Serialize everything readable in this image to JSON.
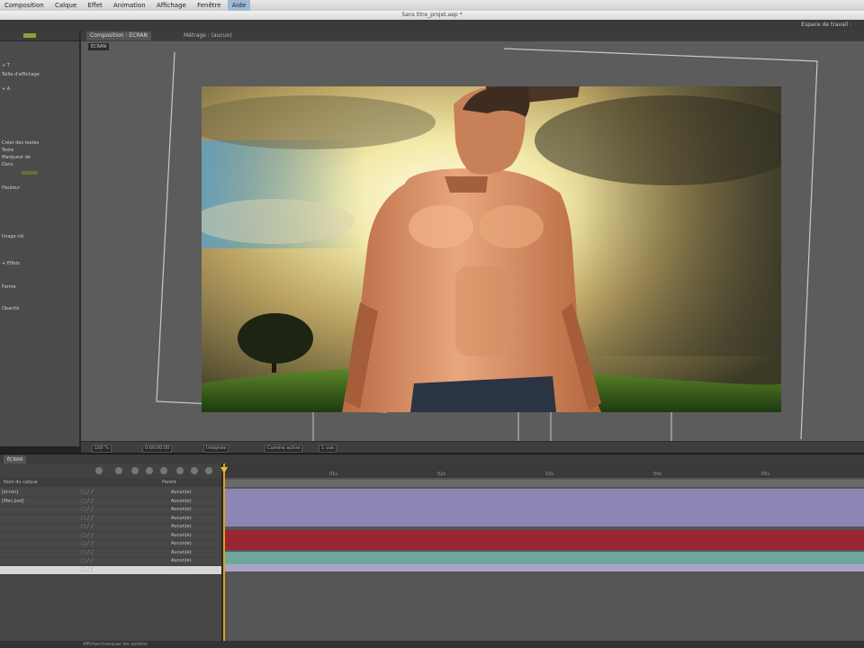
{
  "menu": {
    "items": [
      "Composition",
      "Calque",
      "Effet",
      "Animation",
      "Affichage",
      "Fenêtre",
      "Aide"
    ],
    "selected_index": 6
  },
  "window": {
    "title": "Sans titre_projet.aep *"
  },
  "workspace": {
    "label": "Espace de travail :"
  },
  "left_panel": {
    "rows": [
      "+ T",
      "Taille d'affichage",
      "+ A",
      "Créer des textes",
      "Texte",
      "Marqueur de",
      "Dans",
      "Hauteur",
      "Image clé",
      "+ Effets",
      "Forme",
      "Opacité"
    ]
  },
  "comp_panel": {
    "tabs": [
      "Composition : ÉCRAN",
      "Métrage : (aucun)"
    ],
    "active_tab": 0,
    "badge": "ÉCRAN"
  },
  "viewer_controls": [
    "100 %",
    "0:00:00:00",
    "Intégrale",
    "Caméra active",
    "1 vue"
  ],
  "timeline": {
    "tab": "ÉCRAN",
    "header": {
      "col_source": "Nom du calque",
      "col_parent": "Parent"
    },
    "layers": [
      {
        "name": "[écran]",
        "parent": "Aucun(e)"
      },
      {
        "name": "[Mec.psd]",
        "parent": "Aucun(e)"
      },
      {
        "name": "",
        "parent": "Aucun(e)"
      },
      {
        "name": "",
        "parent": "Aucun(e)"
      },
      {
        "name": "",
        "parent": "Aucun(e)"
      },
      {
        "name": "",
        "parent": "Aucun(e)"
      },
      {
        "name": "",
        "parent": "Aucun(e)"
      },
      {
        "name": "",
        "parent": "Aucun(e)"
      },
      {
        "name": "",
        "parent": "Aucun(e)"
      },
      {
        "name": "",
        "parent": "Aucun(e)"
      }
    ],
    "ruler_ticks": [
      "01s",
      "02s",
      "03s",
      "04s",
      "05s"
    ],
    "bar_colors": [
      "#8d86b4",
      "#8d86b4",
      "#9b2433",
      "#9b2433",
      "#6fa69a",
      "#a9a4c6"
    ]
  },
  "status": {
    "text": "Afficher/masquer les options"
  },
  "colors": {
    "accent": "#8ba23a",
    "cti": "#f2b830",
    "lavender": "#8d86b4",
    "red": "#9b2433",
    "teal": "#6fa69a"
  }
}
